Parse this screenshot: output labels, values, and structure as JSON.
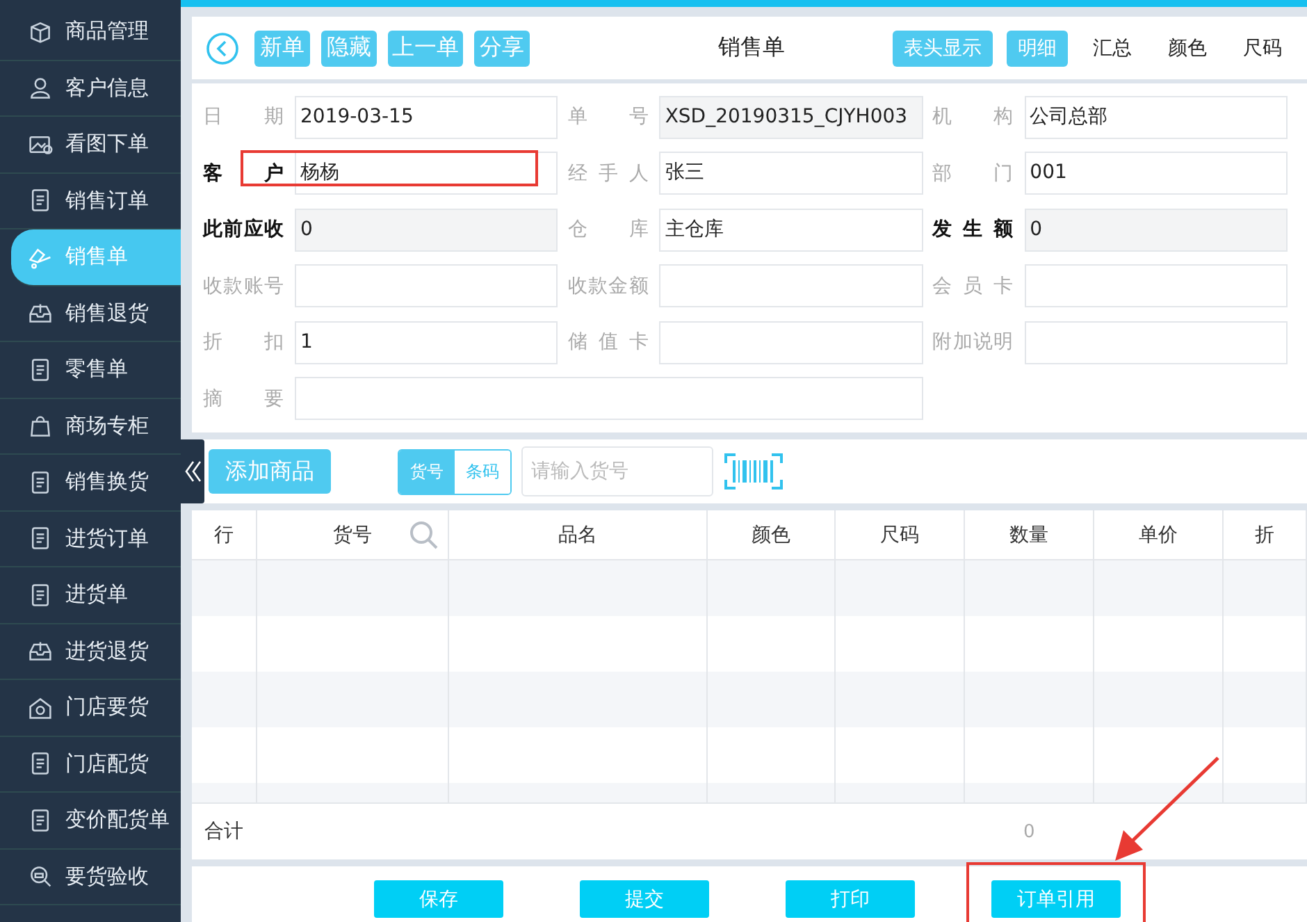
{
  "sidebar": {
    "items": [
      {
        "label": "商品管理",
        "selected": false
      },
      {
        "label": "客户信息",
        "selected": false
      },
      {
        "label": "看图下单",
        "selected": false
      },
      {
        "label": "销售订单",
        "selected": false
      },
      {
        "label": "销售单",
        "selected": true
      },
      {
        "label": "销售退货",
        "selected": false
      },
      {
        "label": "零售单",
        "selected": false
      },
      {
        "label": "商场专柜",
        "selected": false
      },
      {
        "label": "销售换货",
        "selected": false
      },
      {
        "label": "进货订单",
        "selected": false
      },
      {
        "label": "进货单",
        "selected": false
      },
      {
        "label": "进货退货",
        "selected": false
      },
      {
        "label": "门店要货",
        "selected": false
      },
      {
        "label": "门店配货",
        "selected": false
      },
      {
        "label": "变价配货单",
        "selected": false
      },
      {
        "label": "要货验收",
        "selected": false
      }
    ]
  },
  "toolbar": {
    "actions": [
      "新单",
      "隐藏",
      "上一单",
      "分享"
    ],
    "title": "销售单",
    "header_toggle": {
      "label": "表头显示",
      "on": true
    },
    "views": [
      {
        "label": "明细",
        "selected": true
      },
      {
        "label": "汇总",
        "selected": false
      },
      {
        "label": "颜色",
        "selected": false
      },
      {
        "label": "尺码",
        "selected": false
      }
    ]
  },
  "form": {
    "fields": [
      {
        "label": "日期",
        "value": "2019-03-15",
        "bold": false,
        "readonly": false,
        "wide": false,
        "highlighted": false
      },
      {
        "label": "单号",
        "value": "XSD_20190315_CJYH003",
        "bold": false,
        "readonly": true,
        "wide": false,
        "highlighted": false
      },
      {
        "label": "机构",
        "value": "公司总部",
        "bold": false,
        "readonly": false,
        "wide": false,
        "highlighted": false
      },
      {
        "label": "客户",
        "value": "杨杨",
        "bold": true,
        "readonly": false,
        "wide": false,
        "highlighted": true
      },
      {
        "label": "经手人",
        "value": "张三",
        "bold": false,
        "readonly": false,
        "wide": false,
        "highlighted": false
      },
      {
        "label": "部门",
        "value": "001",
        "bold": false,
        "readonly": false,
        "wide": false,
        "highlighted": false
      },
      {
        "label": "此前应收",
        "value": "0",
        "bold": true,
        "readonly": true,
        "wide": false,
        "highlighted": false
      },
      {
        "label": "仓库",
        "value": "主仓库",
        "bold": false,
        "readonly": false,
        "wide": false,
        "highlighted": false
      },
      {
        "label": "发生额",
        "value": "0",
        "bold": true,
        "readonly": true,
        "wide": false,
        "highlighted": false
      },
      {
        "label": "收款账号",
        "bold": false,
        "readonly": false,
        "wide": false,
        "highlighted": false
      },
      {
        "label": "收款金额",
        "bold": false,
        "readonly": false,
        "wide": false,
        "highlighted": false
      },
      {
        "label": "会员卡",
        "bold": false,
        "readonly": false,
        "wide": false,
        "highlighted": false
      },
      {
        "label": "折扣",
        "value": "1",
        "bold": false,
        "readonly": false,
        "wide": false,
        "highlighted": false
      },
      {
        "label": "储值卡",
        "bold": false,
        "readonly": false,
        "wide": false,
        "highlighted": false
      },
      {
        "label": "附加说明",
        "bold": false,
        "readonly": false,
        "wide": false,
        "highlighted": false
      },
      {
        "label": "摘要",
        "bold": false,
        "readonly": false,
        "wide": true,
        "highlighted": false
      }
    ]
  },
  "entry_bar": {
    "add_button": "添加商品",
    "modes": [
      {
        "label": "货号",
        "selected": true
      },
      {
        "label": "条码",
        "selected": false
      }
    ],
    "search": {
      "placeholder": "请输入货号"
    }
  },
  "table": {
    "columns": [
      "行",
      "货号",
      "品名",
      "颜色",
      "尺码",
      "数量",
      "单价",
      "折"
    ],
    "total_label": "合计",
    "total_quantity": "0"
  },
  "footer": {
    "buttons": [
      {
        "label": "保存",
        "highlighted": false
      },
      {
        "label": "提交",
        "highlighted": false
      },
      {
        "label": "打印",
        "highlighted": false
      },
      {
        "label": "订单引用",
        "highlighted": true
      }
    ]
  }
}
